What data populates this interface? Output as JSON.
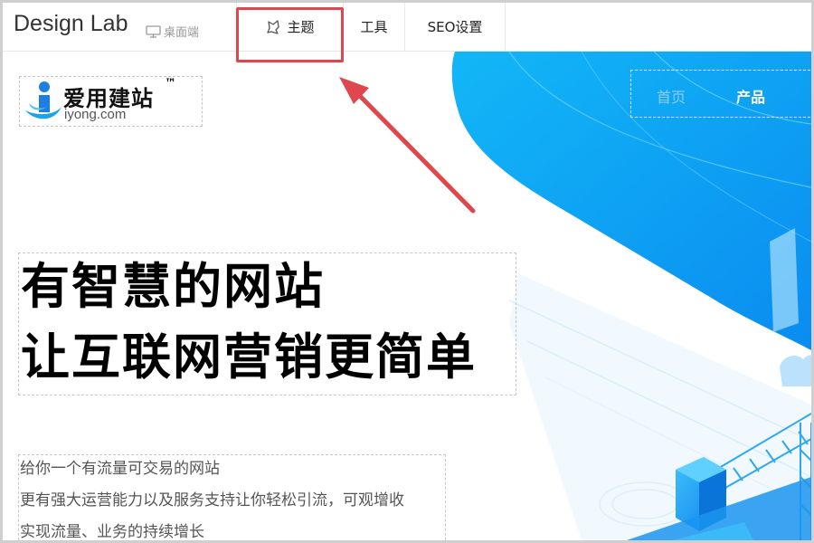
{
  "toolbar": {
    "app_title": "Design Lab",
    "device_label": "桌面端",
    "device_icon": "monitor-icon",
    "tabs": [
      {
        "label": "主题",
        "icon": "theme-icon"
      },
      {
        "label": "工具"
      },
      {
        "label": "SEO设置"
      }
    ]
  },
  "site": {
    "logo_cn": "爱用建站",
    "logo_tm": "™",
    "logo_en": "iyong.com",
    "nav": [
      "首页",
      "产品"
    ],
    "hero": [
      "有智慧的网站",
      "让互联网营销更简单"
    ],
    "description": [
      "给你一个有流量可交易的网站",
      "更有强大运营能力以及服务支持让你轻松引流，可观增收",
      "实现流量、业务的持续增长"
    ]
  },
  "colors": {
    "accent_blue": "#12b4f5",
    "annotation_red": "#e0474c"
  }
}
